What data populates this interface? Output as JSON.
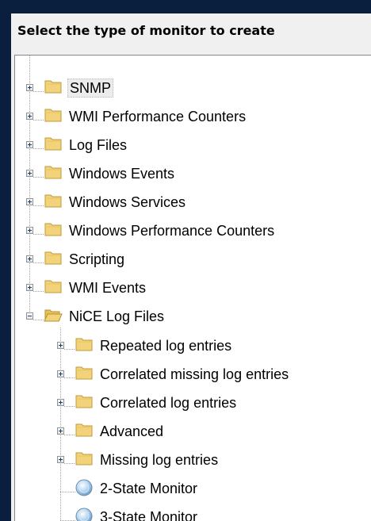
{
  "heading": "Select the type of monitor to create",
  "tree": {
    "root_items": [
      {
        "label": "SNMP",
        "icon": "folder-closed",
        "expanded": false,
        "selected": true
      },
      {
        "label": "WMI Performance Counters",
        "icon": "folder-closed",
        "expanded": false
      },
      {
        "label": "Log Files",
        "icon": "folder-closed",
        "expanded": false
      },
      {
        "label": "Windows Events",
        "icon": "folder-closed",
        "expanded": false
      },
      {
        "label": "Windows Services",
        "icon": "folder-closed",
        "expanded": false
      },
      {
        "label": "Windows Performance Counters",
        "icon": "folder-closed",
        "expanded": false
      },
      {
        "label": "Scripting",
        "icon": "folder-closed",
        "expanded": false
      },
      {
        "label": "WMI Events",
        "icon": "folder-closed",
        "expanded": false
      },
      {
        "label": "NiCE Log Files",
        "icon": "folder-open",
        "expanded": true
      }
    ],
    "child_items": [
      {
        "label": "Repeated log entries",
        "icon": "folder-closed"
      },
      {
        "label": "Correlated missing log entries",
        "icon": "folder-closed"
      },
      {
        "label": "Correlated log entries",
        "icon": "folder-closed"
      },
      {
        "label": "Advanced",
        "icon": "folder-closed"
      },
      {
        "label": "Missing log entries",
        "icon": "folder-closed"
      },
      {
        "label": "2-State Monitor",
        "icon": "monitor-globe"
      },
      {
        "label": "3-State Monitor",
        "icon": "monitor-globe"
      }
    ]
  },
  "colors": {
    "window_background": "#0a1f3d",
    "panel_background": "#f0f0f0",
    "tree_background": "#ffffff",
    "folder": "#f2d27a",
    "selected_highlight": "#ececec"
  }
}
